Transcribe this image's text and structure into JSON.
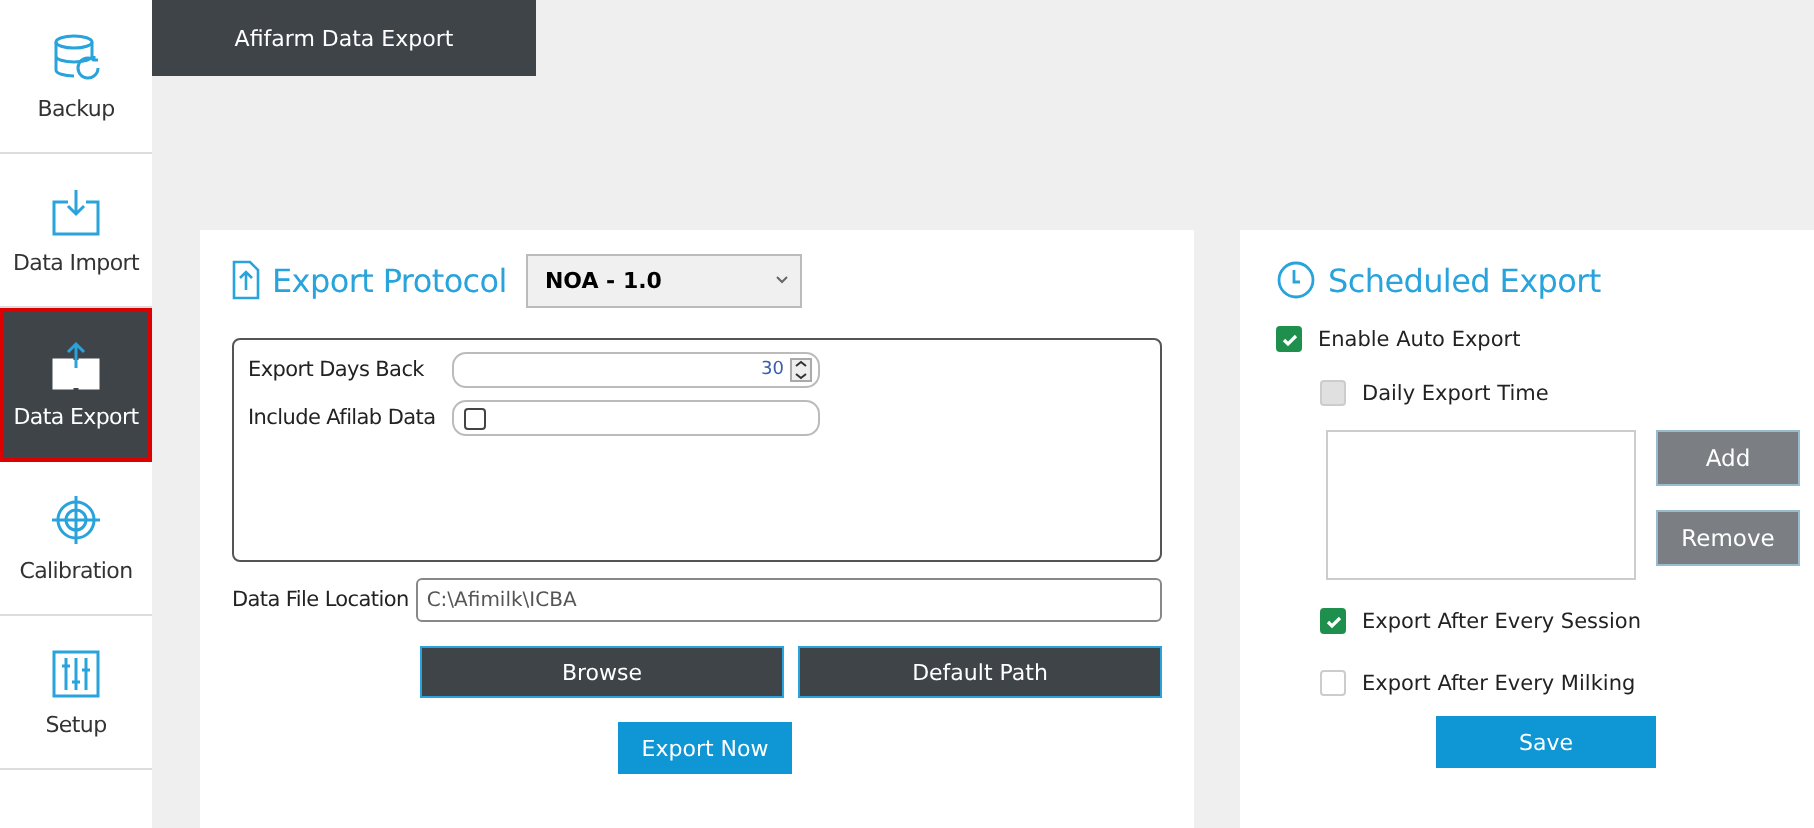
{
  "sidebar": {
    "items": [
      {
        "label": "Backup",
        "kind": "backup",
        "selected": false
      },
      {
        "label": "Data Import",
        "kind": "import",
        "selected": false
      },
      {
        "label": "Data Export",
        "kind": "export",
        "selected": true
      },
      {
        "label": "Calibration",
        "kind": "calibration",
        "selected": false
      },
      {
        "label": "Setup",
        "kind": "setup",
        "selected": false
      }
    ]
  },
  "tabs": [
    {
      "label": "Afifarm Data Export",
      "selected": true
    }
  ],
  "export_protocol": {
    "title": "Export Protocol",
    "protocol_select": "NOA - 1.0",
    "days_back": {
      "label": "Export Days Back",
      "value": "30"
    },
    "include_afilab": {
      "label": "Include Afilab Data",
      "checked": false
    },
    "data_file_location": {
      "label": "Data File Location",
      "value": "C:\\Afimilk\\ICBA"
    },
    "buttons": [
      {
        "label": "Browse",
        "kind": "dark"
      },
      {
        "label": "Default Path",
        "kind": "dark"
      },
      {
        "label": "Export Now",
        "kind": "primary"
      }
    ]
  },
  "scheduled_export": {
    "title": "Scheduled Export",
    "enable_auto_export": {
      "label": "Enable Auto Export",
      "checked": true,
      "disabled": false
    },
    "daily_export_time": {
      "label": "Daily Export Time",
      "checked": false,
      "disabled": true
    },
    "time_buttons": [
      {
        "label": "Add",
        "disabled": true
      },
      {
        "label": "Remove",
        "disabled": true
      }
    ],
    "after_session": {
      "label": "Export After Every Session",
      "checked": true,
      "disabled": false
    },
    "after_milking": {
      "label": "Export After Every Milking",
      "checked": false,
      "disabled": false
    },
    "save_button": "Save"
  }
}
